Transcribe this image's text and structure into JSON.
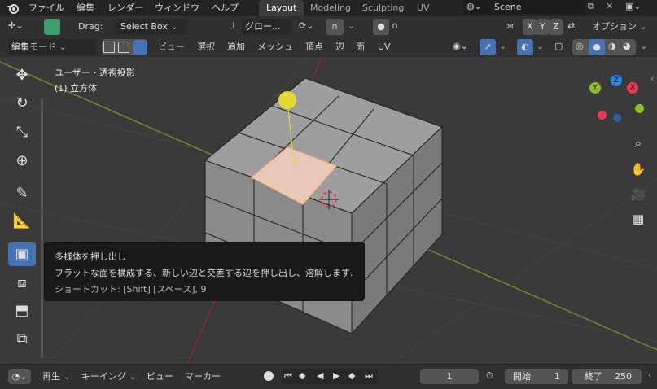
{
  "topbar": {
    "menus": [
      "ファイル",
      "編集",
      "レンダー",
      "ウィンドウ",
      "ヘルプ"
    ],
    "workspaces": [
      "Layout",
      "Modeling",
      "Sculpting",
      "UV Editing"
    ],
    "active_workspace": "Layout",
    "scene_name": "Scene"
  },
  "tool_header": {
    "drag_label": "Drag:",
    "drag_value": "Select Box",
    "orientation_value": "グロー...",
    "axes": [
      "X",
      "Y",
      "Z"
    ],
    "options_label": "オプション"
  },
  "view_header": {
    "mode_value": "編集モード",
    "menus": [
      "ビュー",
      "選択",
      "追加",
      "メッシュ",
      "頂点",
      "辺",
      "面",
      "UV"
    ]
  },
  "viewport": {
    "view_title": "ユーザー・透視投影",
    "object_info": "(1) 立方体",
    "gizmo_axes": [
      "X",
      "Y",
      "Z"
    ]
  },
  "tooltip": {
    "title": "多様体を押し出し",
    "description": "フラットな面を構成する、新しい辺と交差する辺を押し出し、溶解します.",
    "shortcut": "ショートカット: [Shift] [スペース], 9"
  },
  "timeline": {
    "playback_label": "再生",
    "keying_label": "キーイング",
    "view_label": "ビュー",
    "marker_label": "マーカー",
    "current_frame": "1",
    "start_label": "開始",
    "start_value": "1",
    "end_label": "終了",
    "end_value": "250"
  },
  "colors": {
    "accent": "#4772b3",
    "x_axis": "#e83a4f",
    "y_axis": "#8cbd26",
    "z_axis": "#2f84e6",
    "selected_face": "#e8c8b8",
    "light": "#e6d833"
  }
}
